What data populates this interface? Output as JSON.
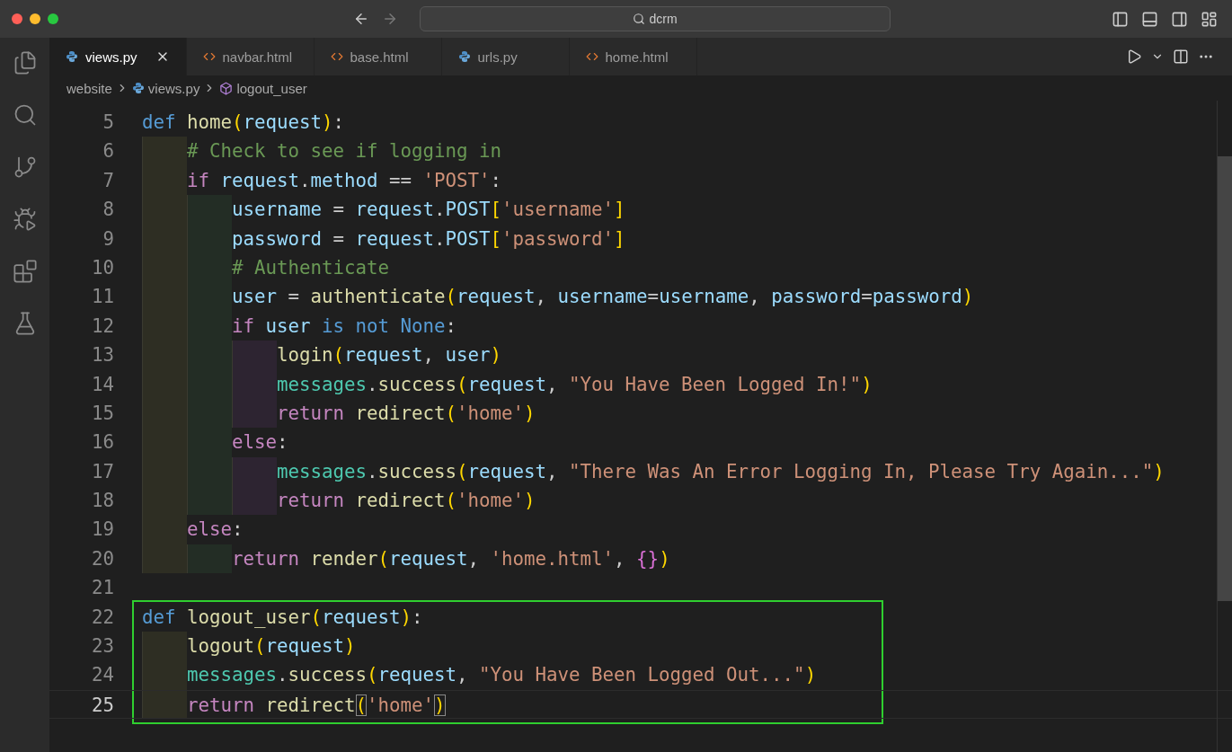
{
  "title_bar": {
    "search": "dcrm",
    "back_disabled": false,
    "forward_disabled": true
  },
  "tabs": [
    {
      "label": "views.py",
      "kind": "python",
      "selected": true
    },
    {
      "label": "navbar.html",
      "kind": "html",
      "selected": false
    },
    {
      "label": "base.html",
      "kind": "html",
      "selected": false
    },
    {
      "label": "urls.py",
      "kind": "python",
      "selected": false
    },
    {
      "label": "home.html",
      "kind": "html",
      "selected": false
    }
  ],
  "breadcrumb": [
    {
      "text": "website",
      "kind": "folder"
    },
    {
      "text": "views.py",
      "kind": "python"
    },
    {
      "text": "logout_user",
      "kind": "symbol"
    }
  ],
  "code": [
    {
      "number": "5",
      "current": false,
      "highlighted": false,
      "tokens": [
        {
          "text": "def ",
          "kind": "keyword"
        },
        {
          "text": "home",
          "kind": "function"
        },
        {
          "text": "(",
          "kind": "bracket"
        },
        {
          "text": "request",
          "kind": "variable"
        },
        {
          "text": ")",
          "kind": "bracket"
        },
        {
          "text": ":",
          "kind": "punct"
        }
      ],
      "children": [
        {
          "number": "6",
          "current": false,
          "tokens": [
            {
              "text": "# Check to see if logging in",
              "kind": "comment"
            }
          ]
        },
        {
          "number": "7",
          "current": false,
          "tokens": [
            {
              "text": "if ",
              "kind": "control"
            },
            {
              "text": "request",
              "kind": "variable"
            },
            {
              "text": ".",
              "kind": "punct"
            },
            {
              "text": "method",
              "kind": "variable"
            },
            {
              "text": " == ",
              "kind": "punct"
            },
            {
              "text": "'POST'",
              "kind": "string"
            },
            {
              "text": ":",
              "kind": "punct"
            }
          ],
          "children": [
            {
              "number": "8",
              "current": false,
              "tokens": [
                {
                  "text": "username",
                  "kind": "variable"
                },
                {
                  "text": " = ",
                  "kind": "punct"
                },
                {
                  "text": "request",
                  "kind": "variable"
                },
                {
                  "text": ".",
                  "kind": "punct"
                },
                {
                  "text": "POST",
                  "kind": "variable"
                },
                {
                  "text": "[",
                  "kind": "bracket"
                },
                {
                  "text": "'username'",
                  "kind": "string"
                },
                {
                  "text": "]",
                  "kind": "bracket"
                }
              ]
            },
            {
              "number": "9",
              "current": false,
              "tokens": [
                {
                  "text": "password",
                  "kind": "variable"
                },
                {
                  "text": " = ",
                  "kind": "punct"
                },
                {
                  "text": "request",
                  "kind": "variable"
                },
                {
                  "text": ".",
                  "kind": "punct"
                },
                {
                  "text": "POST",
                  "kind": "variable"
                },
                {
                  "text": "[",
                  "kind": "bracket"
                },
                {
                  "text": "'password'",
                  "kind": "string"
                },
                {
                  "text": "]",
                  "kind": "bracket"
                }
              ]
            },
            {
              "number": "10",
              "current": false,
              "tokens": [
                {
                  "text": "# Authenticate",
                  "kind": "comment"
                }
              ]
            },
            {
              "number": "11",
              "current": false,
              "tokens": [
                {
                  "text": "user",
                  "kind": "variable"
                },
                {
                  "text": " = ",
                  "kind": "punct"
                },
                {
                  "text": "authenticate",
                  "kind": "function"
                },
                {
                  "text": "(",
                  "kind": "bracket"
                },
                {
                  "text": "request",
                  "kind": "variable"
                },
                {
                  "text": ", ",
                  "kind": "punct"
                },
                {
                  "text": "username",
                  "kind": "variable"
                },
                {
                  "text": "=",
                  "kind": "punct"
                },
                {
                  "text": "username",
                  "kind": "variable"
                },
                {
                  "text": ", ",
                  "kind": "punct"
                },
                {
                  "text": "password",
                  "kind": "variable"
                },
                {
                  "text": "=",
                  "kind": "punct"
                },
                {
                  "text": "password",
                  "kind": "variable"
                },
                {
                  "text": ")",
                  "kind": "bracket"
                }
              ]
            },
            {
              "number": "12",
              "current": false,
              "tokens": [
                {
                  "text": "if ",
                  "kind": "control"
                },
                {
                  "text": "user",
                  "kind": "variable"
                },
                {
                  "text": " is not None",
                  "kind": "constant"
                },
                {
                  "text": ":",
                  "kind": "punct"
                }
              ],
              "children": [
                {
                  "number": "13",
                  "current": false,
                  "tokens": [
                    {
                      "text": "login",
                      "kind": "function"
                    },
                    {
                      "text": "(",
                      "kind": "bracket"
                    },
                    {
                      "text": "request",
                      "kind": "variable"
                    },
                    {
                      "text": ", ",
                      "kind": "punct"
                    },
                    {
                      "text": "user",
                      "kind": "variable"
                    },
                    {
                      "text": ")",
                      "kind": "bracket"
                    }
                  ]
                },
                {
                  "number": "14",
                  "current": false,
                  "tokens": [
                    {
                      "text": "messages",
                      "kind": "module"
                    },
                    {
                      "text": ".",
                      "kind": "punct"
                    },
                    {
                      "text": "success",
                      "kind": "function"
                    },
                    {
                      "text": "(",
                      "kind": "bracket"
                    },
                    {
                      "text": "request",
                      "kind": "variable"
                    },
                    {
                      "text": ", ",
                      "kind": "punct"
                    },
                    {
                      "text": "\"You Have Been Logged In!\"",
                      "kind": "string"
                    },
                    {
                      "text": ")",
                      "kind": "bracket"
                    }
                  ]
                },
                {
                  "number": "15",
                  "current": false,
                  "tokens": [
                    {
                      "text": "return ",
                      "kind": "control"
                    },
                    {
                      "text": "redirect",
                      "kind": "function"
                    },
                    {
                      "text": "(",
                      "kind": "bracket"
                    },
                    {
                      "text": "'home'",
                      "kind": "string"
                    },
                    {
                      "text": ")",
                      "kind": "bracket"
                    }
                  ]
                }
              ]
            },
            {
              "number": "16",
              "current": false,
              "tokens": [
                {
                  "text": "else",
                  "kind": "control"
                },
                {
                  "text": ":",
                  "kind": "punct"
                }
              ],
              "children": [
                {
                  "number": "17",
                  "current": false,
                  "tokens": [
                    {
                      "text": "messages",
                      "kind": "module"
                    },
                    {
                      "text": ".",
                      "kind": "punct"
                    },
                    {
                      "text": "success",
                      "kind": "function"
                    },
                    {
                      "text": "(",
                      "kind": "bracket"
                    },
                    {
                      "text": "request",
                      "kind": "variable"
                    },
                    {
                      "text": ", ",
                      "kind": "punct"
                    },
                    {
                      "text": "\"There Was An Error Logging In, Please Try Again...\"",
                      "kind": "string"
                    },
                    {
                      "text": ")",
                      "kind": "bracket"
                    }
                  ]
                },
                {
                  "number": "18",
                  "current": false,
                  "tokens": [
                    {
                      "text": "return ",
                      "kind": "control"
                    },
                    {
                      "text": "redirect",
                      "kind": "function"
                    },
                    {
                      "text": "(",
                      "kind": "bracket"
                    },
                    {
                      "text": "'home'",
                      "kind": "string"
                    },
                    {
                      "text": ")",
                      "kind": "bracket"
                    }
                  ]
                }
              ]
            }
          ]
        },
        {
          "number": "19",
          "current": false,
          "tokens": [
            {
              "text": "else",
              "kind": "control"
            },
            {
              "text": ":",
              "kind": "punct"
            }
          ],
          "children": [
            {
              "number": "20",
              "current": false,
              "tokens": [
                {
                  "text": "return ",
                  "kind": "control"
                },
                {
                  "text": "render",
                  "kind": "function"
                },
                {
                  "text": "(",
                  "kind": "bracket"
                },
                {
                  "text": "request",
                  "kind": "variable"
                },
                {
                  "text": ", ",
                  "kind": "punct"
                },
                {
                  "text": "'home.html'",
                  "kind": "string"
                },
                {
                  "text": ", ",
                  "kind": "punct"
                },
                {
                  "text": "{}",
                  "kind": "bracket2"
                },
                {
                  "text": ")",
                  "kind": "bracket"
                }
              ]
            }
          ]
        }
      ]
    },
    {
      "number": "21",
      "current": false,
      "highlighted": false
    },
    {
      "number": "22",
      "current": false,
      "highlighted": true,
      "tokens": [
        {
          "text": "def ",
          "kind": "keyword"
        },
        {
          "text": "logout_user",
          "kind": "function"
        },
        {
          "text": "(",
          "kind": "bracket"
        },
        {
          "text": "request",
          "kind": "variable"
        },
        {
          "text": ")",
          "kind": "bracket"
        },
        {
          "text": ":",
          "kind": "punct"
        }
      ],
      "children": [
        {
          "number": "23",
          "current": false,
          "tokens": [
            {
              "text": "logout",
              "kind": "function"
            },
            {
              "text": "(",
              "kind": "bracket"
            },
            {
              "text": "request",
              "kind": "variable"
            },
            {
              "text": ")",
              "kind": "bracket"
            }
          ]
        },
        {
          "number": "24",
          "current": false,
          "tokens": [
            {
              "text": "messages",
              "kind": "module"
            },
            {
              "text": ".",
              "kind": "punct"
            },
            {
              "text": "success",
              "kind": "function"
            },
            {
              "text": "(",
              "kind": "bracket"
            },
            {
              "text": "request",
              "kind": "variable"
            },
            {
              "text": ", ",
              "kind": "punct"
            },
            {
              "text": "\"You Have Been Logged Out...\"",
              "kind": "string"
            },
            {
              "text": ")",
              "kind": "bracket"
            }
          ]
        },
        {
          "number": "25",
          "current": true,
          "tokens": [
            {
              "text": "return ",
              "kind": "control"
            },
            {
              "text": "redirect",
              "kind": "function"
            },
            {
              "text": "(",
              "kind": "matched_bracket"
            },
            {
              "text": "'home'",
              "kind": "string"
            },
            {
              "text": ")",
              "kind": "matched_bracket"
            }
          ]
        }
      ]
    }
  ]
}
